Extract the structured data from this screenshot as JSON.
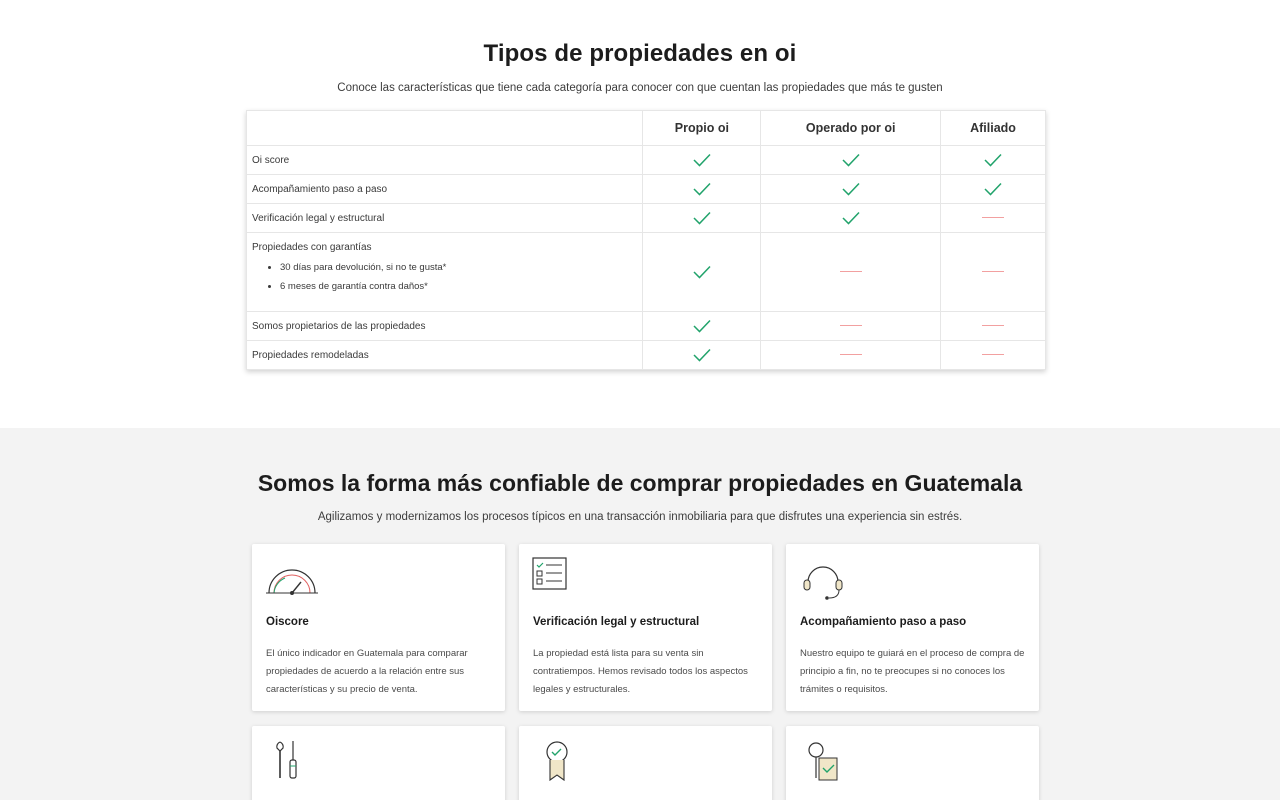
{
  "top_section": {
    "title": "Tipos de propiedades en oi",
    "subtitle": "Conoce las características que tiene cada categoría para conocer con que cuentan las propiedades que más te gusten"
  },
  "compare_table": {
    "columns": [
      "",
      "Propio oi",
      "Operado por oi",
      "Afiliado"
    ],
    "rows": [
      {
        "label": "Oi score",
        "values": [
          "check",
          "check",
          "check"
        ]
      },
      {
        "label": "Acompañamiento paso a paso",
        "values": [
          "check",
          "check",
          "check"
        ]
      },
      {
        "label": "Verificación legal y estructural",
        "values": [
          "check",
          "check",
          "dash"
        ]
      },
      {
        "label": "Propiedades con garantías",
        "bullets": [
          "30 días para devolución, si no te gusta*",
          "6 meses de garantía contra daños*"
        ],
        "values": [
          "check",
          "dash",
          "dash"
        ]
      },
      {
        "label": "Somos propietarios de las propiedades",
        "values": [
          "check",
          "dash",
          "dash"
        ]
      },
      {
        "label": "Propiedades remodeladas",
        "values": [
          "check",
          "dash",
          "dash"
        ]
      }
    ],
    "check_color": "#21a36b",
    "dash_color": "#f2a0a0"
  },
  "bottom_section": {
    "title": "Somos la forma más confiable de comprar propiedades en Guatemala",
    "subtitle": "Agilizamos y modernizamos los procesos típicos en una transacción inmobiliaria para que disfrutes una experiencia sin estrés.",
    "cards": [
      {
        "icon": "gauge-icon",
        "title": "Oiscore",
        "text": "El único indicador en Guatemala para comparar propiedades de acuerdo a la relación entre sus características y su precio de venta."
      },
      {
        "icon": "checklist-icon",
        "title": "Verificación legal y estructural",
        "text": "La propiedad está lista para su venta sin contratiempos. Hemos revisado todos los aspectos legales y estructurales."
      },
      {
        "icon": "headset-icon",
        "title": "Acompañamiento paso a paso",
        "text": "Nuestro equipo te guiará en el proceso de compra de principio a fin, no te preocupes si no conoces los trámites o requisitos."
      },
      {
        "icon": "tools-icon",
        "title": "",
        "text": ""
      },
      {
        "icon": "award-ribbon-icon",
        "title": "",
        "text": ""
      },
      {
        "icon": "key-tag-icon",
        "title": "",
        "text": ""
      }
    ]
  }
}
